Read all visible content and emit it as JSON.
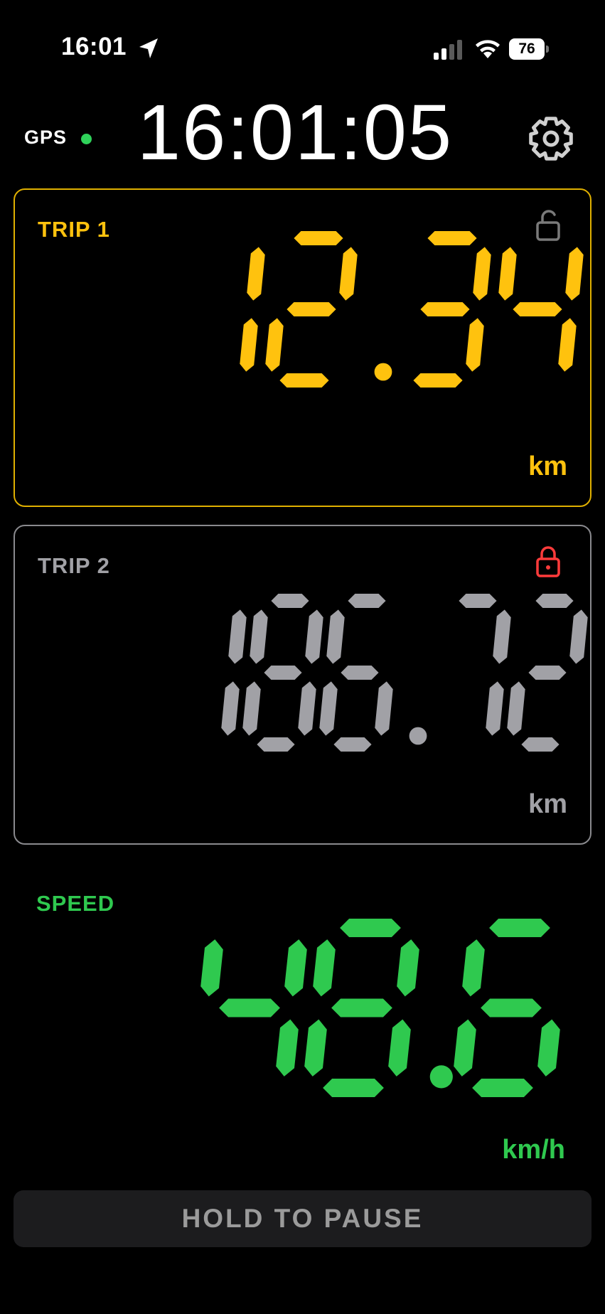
{
  "status_bar": {
    "time": "16:01",
    "battery": "76",
    "icons": [
      "location-arrow-icon",
      "cellular-signal-icon",
      "wifi-icon",
      "battery-icon"
    ]
  },
  "header": {
    "gps_label": "GPS",
    "gps_status_color": "#2fd25a",
    "clock": "16:01:05",
    "settings_icon": "gear-icon"
  },
  "trip1": {
    "title": "TRIP 1",
    "value": "12.34",
    "unit": "km",
    "color": "#ffc20e",
    "locked": false
  },
  "trip2": {
    "title": "TRIP 2",
    "value": "186.72",
    "unit": "km",
    "color": "#a1a1a6",
    "locked": true,
    "lock_color": "#ff3b3b"
  },
  "speed": {
    "title": "SPEED",
    "value": "48.6",
    "unit": "km/h",
    "color": "#2fc94f"
  },
  "pause_button": {
    "label": "HOLD TO PAUSE"
  }
}
